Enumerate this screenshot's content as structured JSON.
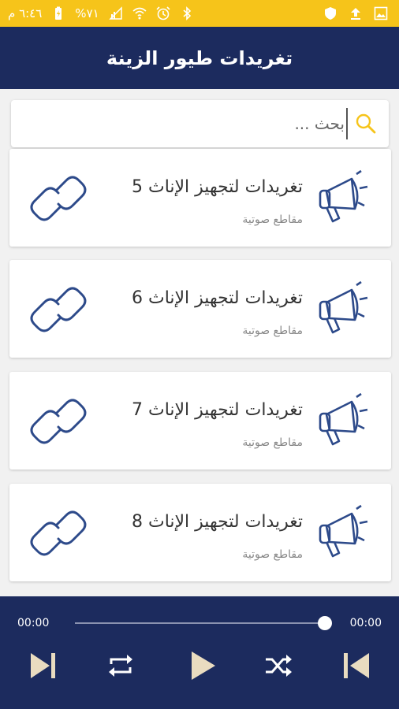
{
  "status_bar": {
    "time": "٦:٤٦ م",
    "battery": "%٧١"
  },
  "app": {
    "title": "تغريدات طيور الزينة"
  },
  "search": {
    "placeholder": "بحث ..."
  },
  "items": [
    {
      "title": "تغريدات لتجهيز الإناث 5",
      "subtitle": "مقاطع صوتية"
    },
    {
      "title": "تغريدات لتجهيز الإناث 6",
      "subtitle": "مقاطع صوتية"
    },
    {
      "title": "تغريدات لتجهيز الإناث 7",
      "subtitle": "مقاطع صوتية"
    },
    {
      "title": "تغريدات لتجهيز الإناث 8",
      "subtitle": "مقاطع صوتية"
    }
  ],
  "player": {
    "current_time": "00:00",
    "total_time": "00:00",
    "progress": 1.0
  },
  "colors": {
    "status_bar": "#f6c41a",
    "primary": "#1c2b5e",
    "icon_accent": "#2d4a8a",
    "player_controls": "#e9dcc0"
  },
  "icons": {
    "status": [
      "gallery-icon",
      "upload-icon",
      "shield-icon",
      "bluetooth-icon",
      "alarm-icon",
      "wifi-icon",
      "signal-icon",
      "battery-icon"
    ],
    "list_item": [
      "megaphone-icon",
      "link-icon"
    ],
    "player": [
      "skip-next-icon",
      "repeat-icon",
      "play-icon",
      "shuffle-icon",
      "skip-previous-icon"
    ]
  }
}
